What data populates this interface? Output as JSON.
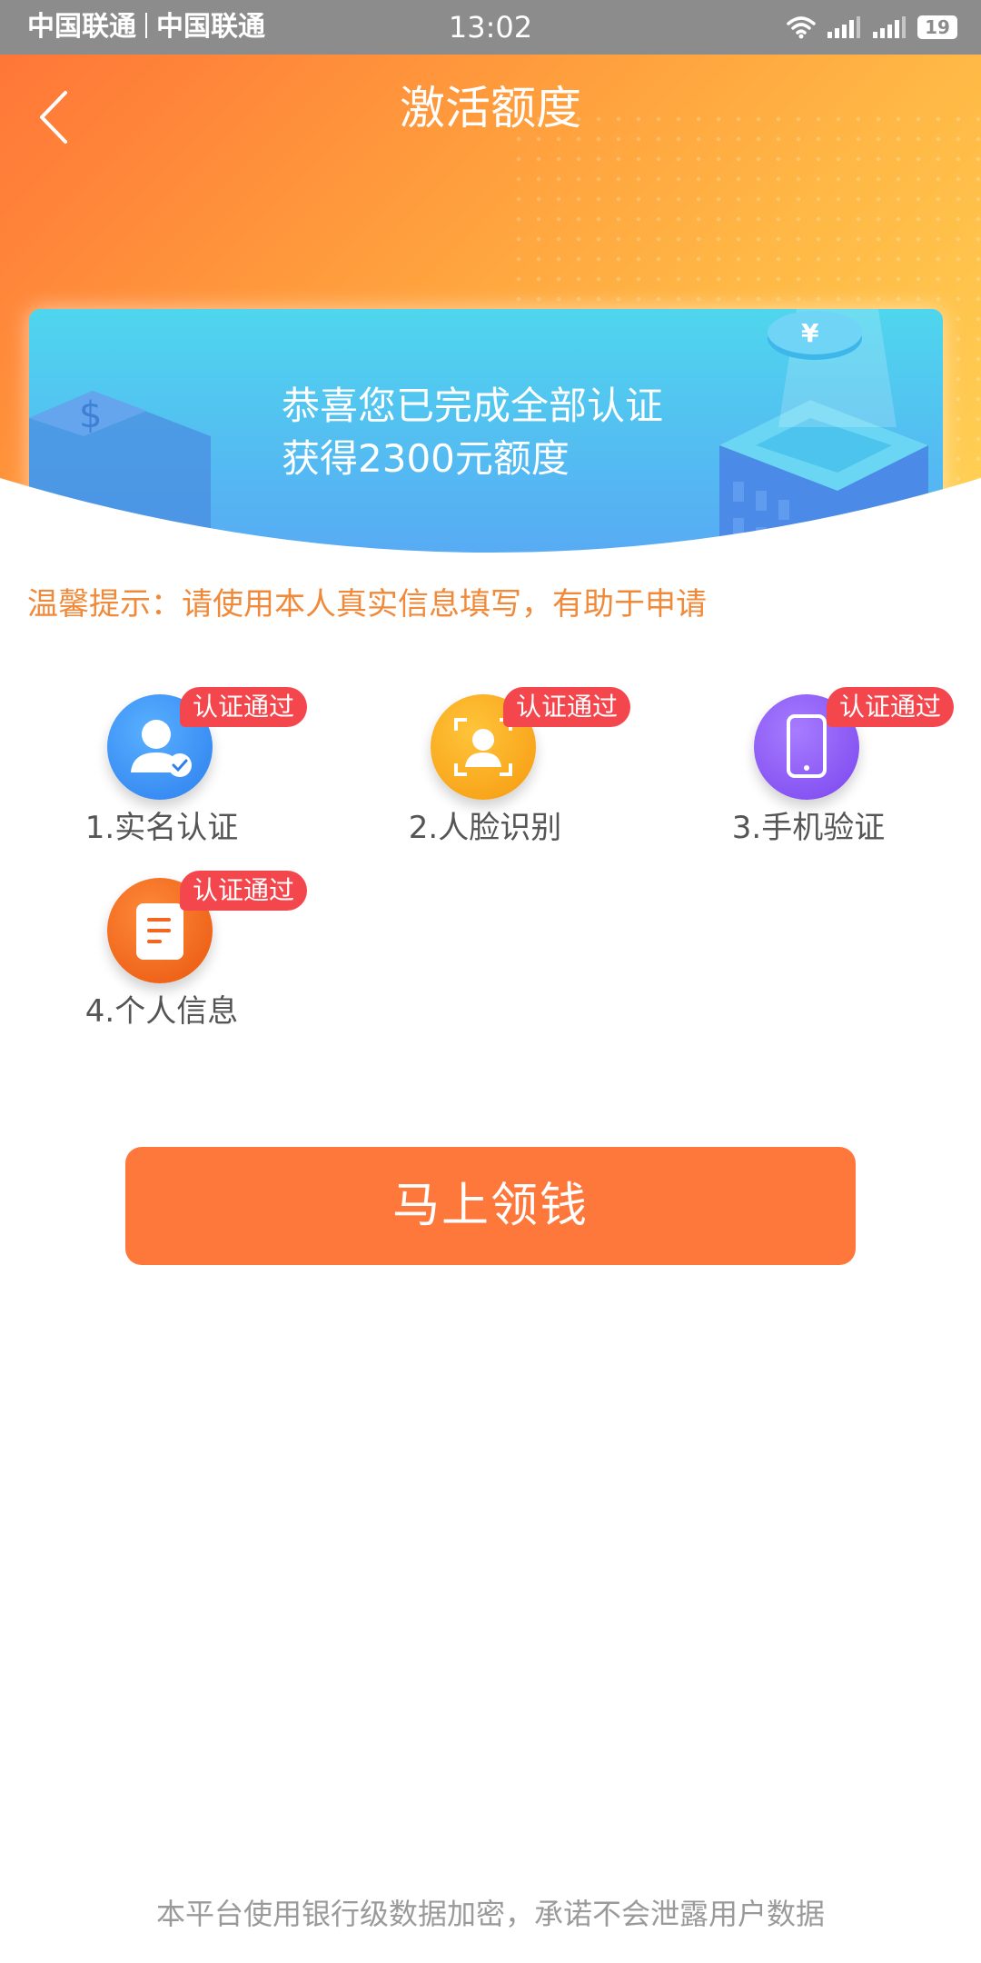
{
  "status_bar": {
    "carrier_1": "中国联通",
    "carrier_2": "中国联通",
    "time": "13:02",
    "battery": "19",
    "icons": [
      "wifi-icon",
      "signal-icon",
      "signal-icon",
      "battery-icon"
    ]
  },
  "header": {
    "title": "激活额度",
    "back_icon": "chevron-left-icon"
  },
  "banner": {
    "line1": "恭喜您已完成全部认证",
    "line2": "获得2300元额度"
  },
  "tip": "温馨提示：请使用本人真实信息填写，有助于申请",
  "steps": [
    {
      "label": "1.实名认证",
      "badge": "认证通过",
      "icon": "user-verified-icon",
      "color": "#3a8ef2"
    },
    {
      "label": "2.人脸识别",
      "badge": "认证通过",
      "icon": "face-scan-icon",
      "color": "#f9a91a"
    },
    {
      "label": "3.手机验证",
      "badge": "认证通过",
      "icon": "mobile-phone-icon",
      "color": "#8a55f0"
    },
    {
      "label": "4.个人信息",
      "badge": "认证通过",
      "icon": "document-icon",
      "color": "#f2661f"
    }
  ],
  "cta": {
    "label": "马上领钱"
  },
  "footer": "本平台使用银行级数据加密，承诺不会泄露用户数据",
  "colors": {
    "accent": "#ff783b",
    "badge": "#f4474d",
    "tip": "#f08a3a"
  }
}
